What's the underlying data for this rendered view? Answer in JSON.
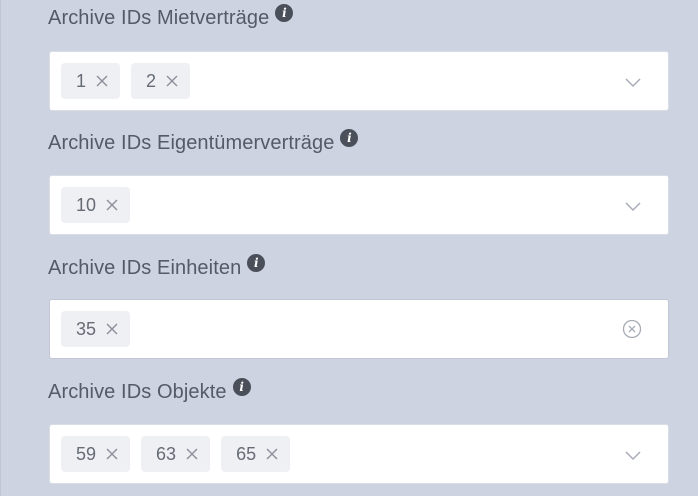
{
  "fields": [
    {
      "label": "Archive IDs Mietverträge",
      "info_icon": "info-icon",
      "tags": [
        "1",
        "2"
      ],
      "suffix_icon": "chevron-down-icon"
    },
    {
      "label": "Archive IDs Eigentümerverträge",
      "info_icon": "info-icon",
      "tags": [
        "10"
      ],
      "suffix_icon": "chevron-down-icon"
    },
    {
      "label": "Archive IDs Einheiten",
      "info_icon": "info-icon",
      "tags": [
        "35"
      ],
      "suffix_icon": "clear-circle-icon"
    },
    {
      "label": "Archive IDs Objekte",
      "info_icon": "info-icon",
      "tags": [
        "59",
        "63",
        "65"
      ],
      "suffix_icon": "chevron-down-icon"
    }
  ],
  "info_glyph": "i",
  "colors": {
    "background": "#cdd3e0",
    "label": "#555a66",
    "tag_background": "#eef0f4",
    "tag_text": "#666b76",
    "input_background": "#ffffff"
  }
}
